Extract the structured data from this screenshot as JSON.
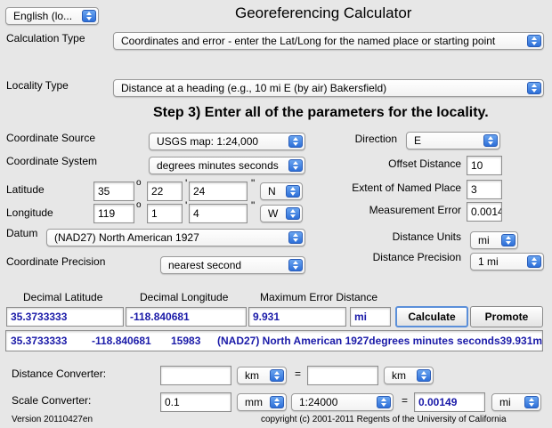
{
  "language": "English (lo...",
  "title": "Georeferencing Calculator",
  "calc_type": {
    "label": "Calculation Type",
    "value": "Coordinates and error - enter the Lat/Long for the named place or starting point"
  },
  "locality_type": {
    "label": "Locality Type",
    "value": "Distance at a heading (e.g., 10 mi E (by air) Bakersfield)"
  },
  "step_heading": "Step 3) Enter all of the parameters for the locality.",
  "coord_source": {
    "label": "Coordinate Source",
    "value": "USGS map: 1:24,000"
  },
  "coord_system": {
    "label": "Coordinate System",
    "value": "degrees minutes seconds"
  },
  "latitude": {
    "label": "Latitude",
    "deg": "35",
    "min": "22",
    "sec": "24",
    "dir": "N"
  },
  "longitude": {
    "label": "Longitude",
    "deg": "119",
    "min": "1",
    "sec": "4",
    "dir": "W"
  },
  "symbols": {
    "deg": "o",
    "min": "'",
    "sec": "\""
  },
  "datum": {
    "label": "Datum",
    "value": "(NAD27) North American 1927"
  },
  "coord_precision": {
    "label": "Coordinate Precision",
    "value": "nearest second"
  },
  "direction": {
    "label": "Direction",
    "value": "E"
  },
  "offset_distance": {
    "label": "Offset Distance",
    "value": "10"
  },
  "extent": {
    "label": "Extent of Named Place",
    "value": "3"
  },
  "measurement_error": {
    "label": "Measurement Error",
    "value": "0.0014"
  },
  "distance_units": {
    "label": "Distance Units",
    "value": "mi"
  },
  "distance_precision": {
    "label": "Distance Precision",
    "value": "1 mi"
  },
  "results": {
    "lat_label": "Decimal Latitude",
    "lon_label": "Decimal Longitude",
    "err_label": "Maximum Error Distance",
    "lat": "35.3733333",
    "lon": "-118.840681",
    "err": "9.931",
    "err_unit": "mi"
  },
  "buttons": {
    "calculate": "Calculate",
    "promote": "Promote"
  },
  "summary": {
    "lat": "35.3733333",
    "lon": "-118.840681",
    "err_m": "15983",
    "rest": "(NAD27) North American 1927degrees minutes seconds39.931m"
  },
  "distance_converter": {
    "label": "Distance Converter:",
    "from_value": "",
    "from_unit": "km",
    "eq": "=",
    "to_value": "",
    "to_unit": "km"
  },
  "scale_converter": {
    "label": "Scale Converter:",
    "value": "0.1",
    "unit": "mm",
    "scale": "1:24000",
    "eq": "=",
    "result": "0.00149",
    "result_unit": "mi"
  },
  "version": "Version 20110427en",
  "copyright": "copyright (c) 2001-2011 Regents of the University of California"
}
